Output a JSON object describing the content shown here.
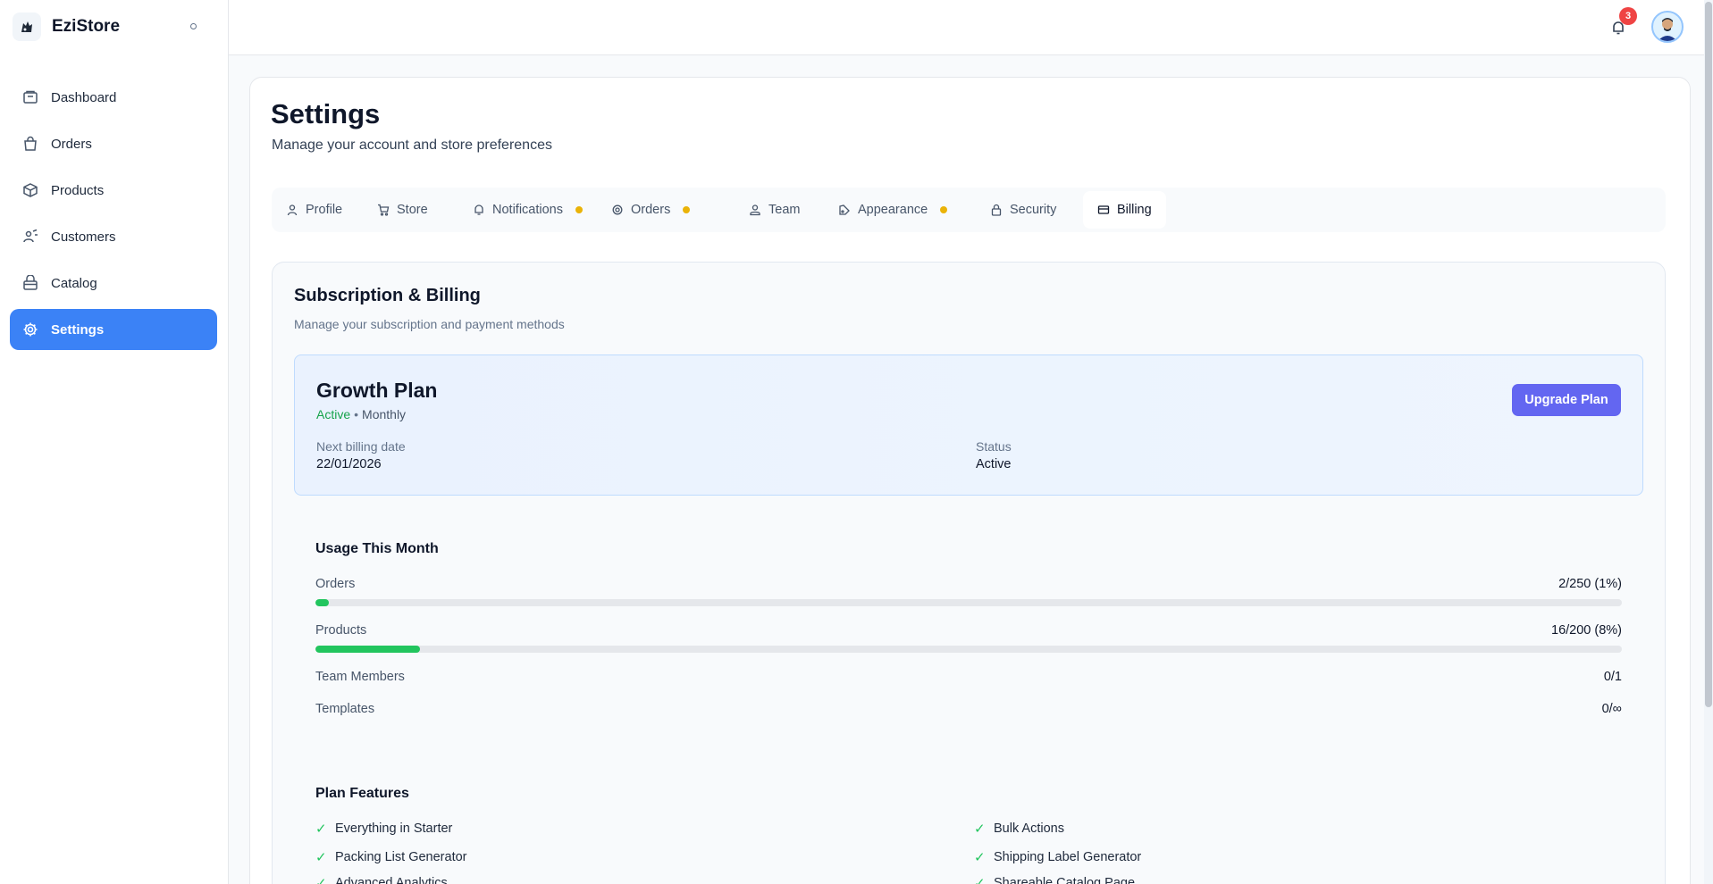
{
  "app": {
    "name": "EziStore"
  },
  "sidebar": {
    "items": [
      {
        "label": "Dashboard",
        "icon": "dashboard-icon"
      },
      {
        "label": "Orders",
        "icon": "bag-icon"
      },
      {
        "label": "Products",
        "icon": "box-icon"
      },
      {
        "label": "Customers",
        "icon": "customers-icon"
      },
      {
        "label": "Catalog",
        "icon": "catalog-icon"
      },
      {
        "label": "Settings",
        "icon": "gear-icon",
        "active": true
      }
    ]
  },
  "header": {
    "notification_count": "3"
  },
  "page": {
    "title": "Settings",
    "subtitle": "Manage your account and store preferences"
  },
  "tabs": [
    {
      "label": "Profile"
    },
    {
      "label": "Store"
    },
    {
      "label": "Notifications",
      "dot": true
    },
    {
      "label": "Orders",
      "dot": true
    },
    {
      "label": "Team"
    },
    {
      "label": "Appearance",
      "dot": true
    },
    {
      "label": "Security"
    },
    {
      "label": "Billing",
      "active": true
    }
  ],
  "billing": {
    "title": "Subscription & Billing",
    "subtitle": "Manage your subscription and payment methods",
    "plan": {
      "name": "Growth Plan",
      "status": "Active",
      "separator": "•",
      "cycle": "Monthly",
      "upgrade_label": "Upgrade Plan",
      "next_billing_label": "Next billing date",
      "next_billing_value": "22/01/2026",
      "status_label": "Status",
      "status_value": "Active"
    },
    "usage": {
      "title": "Usage This Month",
      "rows": [
        {
          "label": "Orders",
          "value": "2/250 (1%)",
          "percent": 1
        },
        {
          "label": "Products",
          "value": "16/200 (8%)",
          "percent": 8
        },
        {
          "label": "Team Members",
          "value": "0/1"
        },
        {
          "label": "Templates",
          "value": "0/∞"
        }
      ]
    },
    "features": {
      "title": "Plan Features",
      "items": [
        "Everything in Starter",
        "Bulk Actions",
        "Packing List Generator",
        "Shipping Label Generator",
        "Advanced Analytics",
        "Shareable Catalog Page"
      ]
    }
  },
  "colors": {
    "accent": "#3b82f6",
    "upgrade": "#6366f1",
    "success": "#22c55e",
    "badge": "#ef4444",
    "tab_dot": "#eab308"
  }
}
